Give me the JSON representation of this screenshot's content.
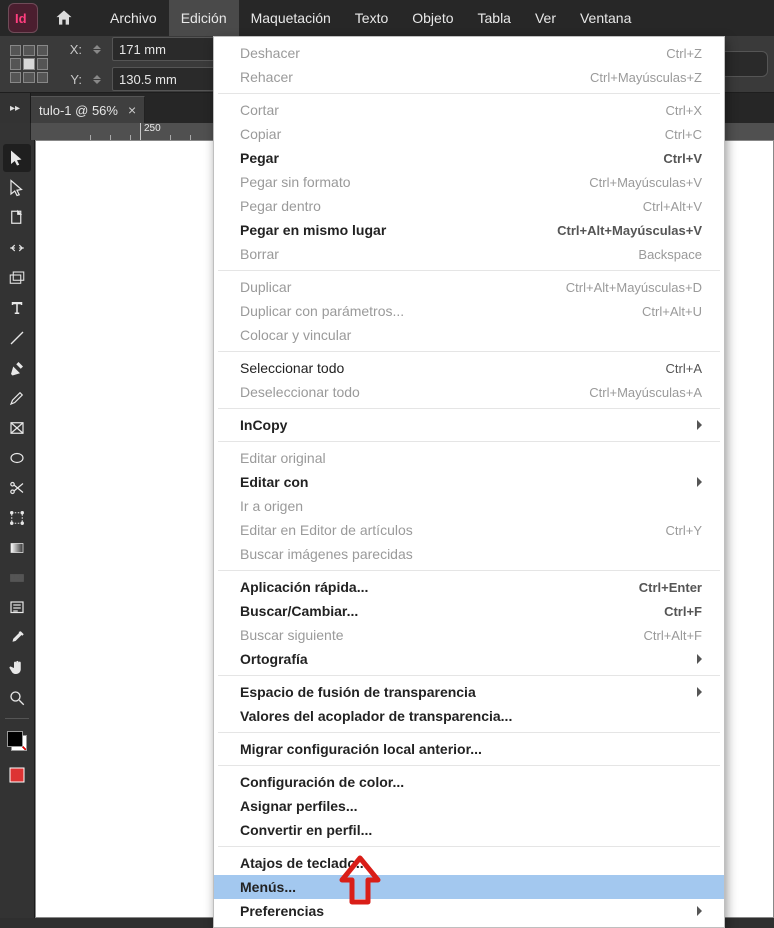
{
  "menubar": {
    "items": [
      "Archivo",
      "Edición",
      "Maquetación",
      "Texto",
      "Objeto",
      "Tabla",
      "Ver",
      "Ventana"
    ]
  },
  "control": {
    "x_label": "X:",
    "y_label": "Y:",
    "x_value": "171 mm",
    "y_value": "130.5 mm"
  },
  "tab": {
    "title": "tulo-1 @ 56%"
  },
  "ruler": {
    "label_250": "250"
  },
  "dropdown": {
    "groups": [
      [
        {
          "label": "Deshacer",
          "shortcut": "Ctrl+Z",
          "dim": true
        },
        {
          "label": "Rehacer",
          "shortcut": "Ctrl+Mayúsculas+Z",
          "dim": true
        }
      ],
      [
        {
          "label": "Cortar",
          "shortcut": "Ctrl+X",
          "dim": true
        },
        {
          "label": "Copiar",
          "shortcut": "Ctrl+C",
          "dim": true
        },
        {
          "label": "Pegar",
          "shortcut": "Ctrl+V",
          "bold": true
        },
        {
          "label": "Pegar sin formato",
          "shortcut": "Ctrl+Mayúsculas+V",
          "dim": true
        },
        {
          "label": "Pegar dentro",
          "shortcut": "Ctrl+Alt+V",
          "dim": true
        },
        {
          "label": "Pegar en mismo lugar",
          "shortcut": "Ctrl+Alt+Mayúsculas+V",
          "bold": true
        },
        {
          "label": "Borrar",
          "shortcut": "Backspace",
          "dim": true
        }
      ],
      [
        {
          "label": "Duplicar",
          "shortcut": "Ctrl+Alt+Mayúsculas+D",
          "dim": true
        },
        {
          "label": "Duplicar con parámetros...",
          "shortcut": "Ctrl+Alt+U",
          "dim": true
        },
        {
          "label": "Colocar y vincular",
          "dim": true
        }
      ],
      [
        {
          "label": "Seleccionar todo",
          "shortcut": "Ctrl+A"
        },
        {
          "label": "Deseleccionar todo",
          "shortcut": "Ctrl+Mayúsculas+A",
          "dim": true
        }
      ],
      [
        {
          "label": "InCopy",
          "sub": true,
          "bold": true
        }
      ],
      [
        {
          "label": "Editar original",
          "dim": true
        },
        {
          "label": "Editar con",
          "sub": true,
          "bold": true
        },
        {
          "label": "Ir a origen",
          "dim": true
        },
        {
          "label": "Editar en Editor de artículos",
          "shortcut": "Ctrl+Y",
          "dim": true
        },
        {
          "label": "Buscar imágenes parecidas",
          "dim": true
        }
      ],
      [
        {
          "label": "Aplicación rápida...",
          "shortcut": "Ctrl+Enter",
          "bold": true
        },
        {
          "label": "Buscar/Cambiar...",
          "shortcut": "Ctrl+F",
          "bold": true
        },
        {
          "label": "Buscar siguiente",
          "shortcut": "Ctrl+Alt+F",
          "dim": true
        },
        {
          "label": "Ortografía",
          "sub": true,
          "bold": true
        }
      ],
      [
        {
          "label": "Espacio de fusión de transparencia",
          "sub": true,
          "bold": true
        },
        {
          "label": "Valores del acoplador de transparencia...",
          "bold": true
        }
      ],
      [
        {
          "label": "Migrar configuración local anterior...",
          "bold": true
        }
      ],
      [
        {
          "label": "Configuración de color...",
          "bold": true
        },
        {
          "label": "Asignar perfiles...",
          "bold": true
        },
        {
          "label": "Convertir en perfil...",
          "bold": true
        }
      ],
      [
        {
          "label": "Atajos de teclado...",
          "bold": true
        },
        {
          "label": "Menús...",
          "bold": true,
          "hl": true
        },
        {
          "label": "Preferencias",
          "sub": true,
          "bold": true
        }
      ]
    ]
  },
  "tools": [
    "selection",
    "direct-selection",
    "page",
    "gap",
    "content-collector",
    "type",
    "line",
    "pen",
    "pencil",
    "rectangle-frame",
    "ellipse",
    "scissors",
    "free-transform",
    "gradient-swatch",
    "gradient-feather",
    "note",
    "eyedropper",
    "hand",
    "zoom"
  ]
}
